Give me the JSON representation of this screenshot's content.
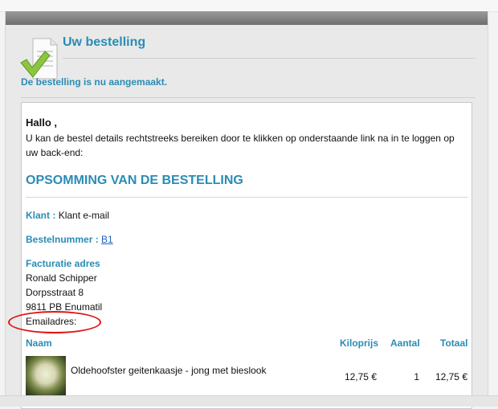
{
  "header": {
    "title": "Uw bestelling",
    "subtitle": "De bestelling is nu aangemaakt."
  },
  "email": {
    "greeting": "Hallo ,",
    "intro": "U kan de bestel details rechtstreeks bereiken door te klikken op onderstaande link na in te loggen op uw back-end:",
    "summary_title": "OPSOMMING VAN DE BESTELLING",
    "customer_label": "Klant :",
    "customer_value": "Klant e-mail",
    "order_number_label": "Bestelnummer :",
    "order_number_value": "B1",
    "billing_label": "Facturatie adres",
    "billing_name": "Ronald Schipper",
    "billing_street": "Dorpsstraat 8",
    "billing_city": "9811 PB Enumatil",
    "email_label": "Emailadres:",
    "table": {
      "headers": {
        "name": "Naam",
        "kiloprijs": "Kiloprijs",
        "aantal": "Aantal",
        "totaal": "Totaal"
      },
      "rows": [
        {
          "name": "Oldehoofster geitenkaasje - jong met bieslook",
          "kiloprijs": "12,75 €",
          "aantal": "1",
          "totaal": "12,75 €"
        }
      ]
    }
  },
  "annotation": {
    "color": "#e01313"
  },
  "icons": {
    "document": "document-checkmark-icon"
  },
  "colors": {
    "accent": "#2a8cb4",
    "link": "#1f63b8"
  }
}
